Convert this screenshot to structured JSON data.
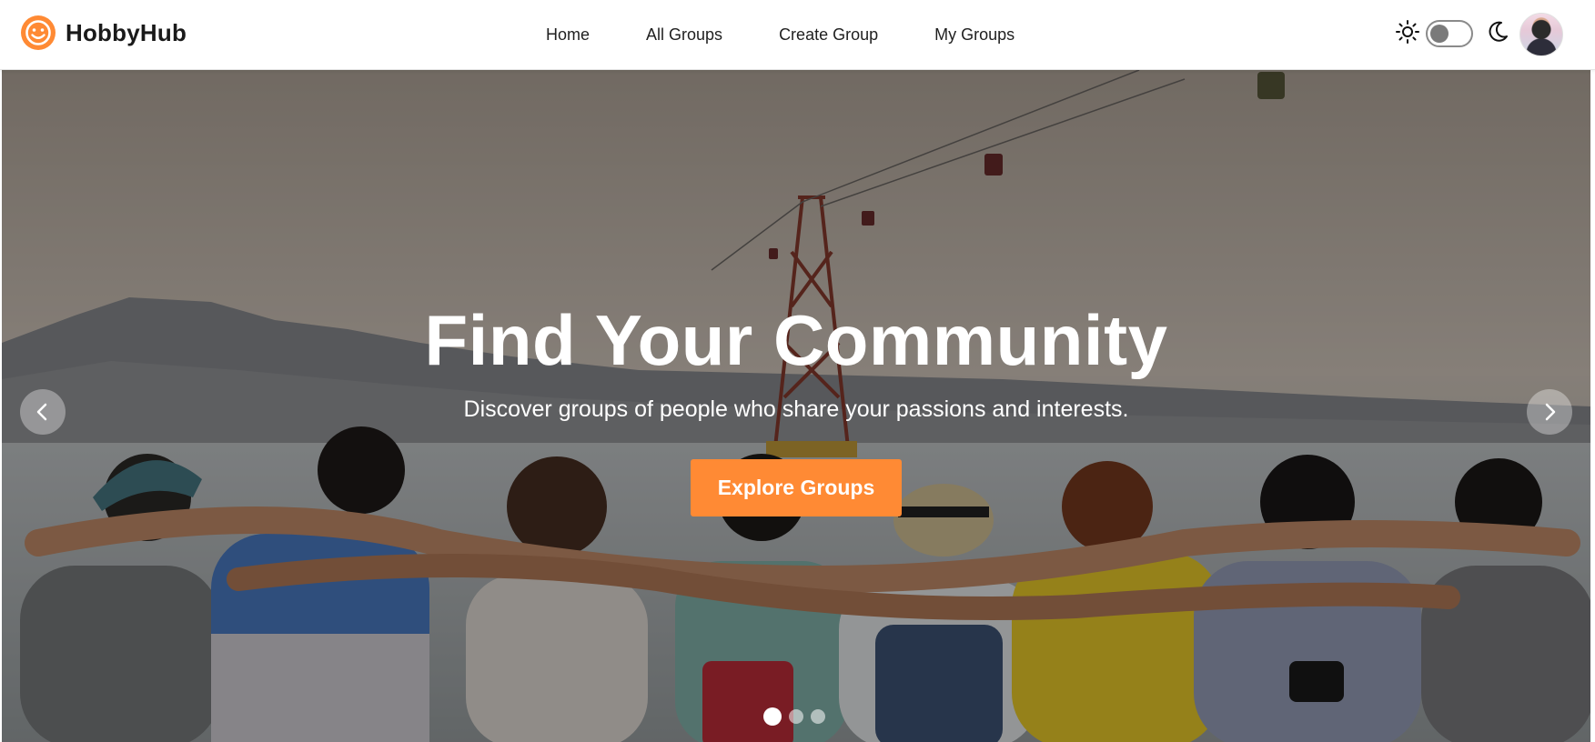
{
  "brand": {
    "name": "HobbyHub",
    "logo_icon": "smiley-face-icon",
    "accent_color": "#ff8a34"
  },
  "nav": {
    "links": [
      {
        "label": "Home"
      },
      {
        "label": "All Groups"
      },
      {
        "label": "Create Group"
      },
      {
        "label": "My Groups"
      }
    ]
  },
  "theme_toggle": {
    "light_icon": "sun-icon",
    "dark_icon": "moon-icon",
    "dark_mode_on": false
  },
  "user": {
    "avatar_icon": "user-avatar"
  },
  "hero": {
    "title": "Find Your Community",
    "subtitle": "Discover groups of people who share your passions and interests.",
    "cta_label": "Explore Groups",
    "prev_icon": "chevron-left-icon",
    "next_icon": "chevron-right-icon",
    "slides_total": 3,
    "active_slide": 1
  }
}
